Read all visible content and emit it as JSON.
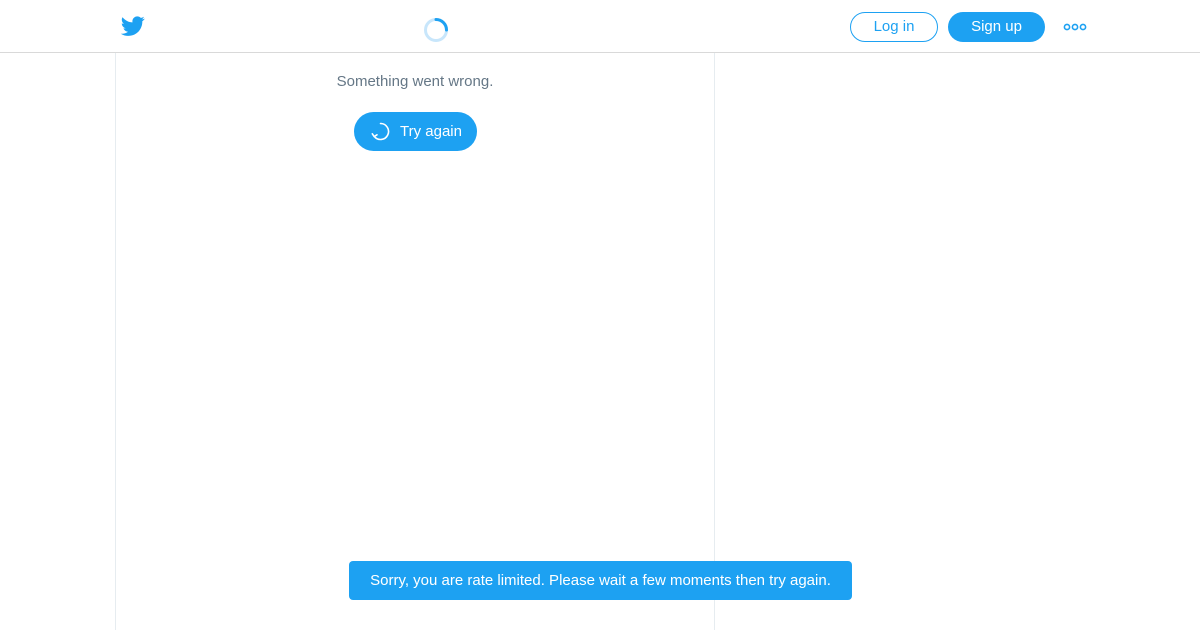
{
  "header": {
    "logo_icon": "twitter-bird-icon",
    "loading_icon": "spinner-icon",
    "login_label": "Log in",
    "signup_label": "Sign up",
    "more_icon": "more-options-icon"
  },
  "main": {
    "error_message": "Something went wrong.",
    "retry_icon": "refresh-icon",
    "retry_label": "Try again"
  },
  "toast": {
    "message": "Sorry, you are rate limited. Please wait a few moments then try again."
  },
  "colors": {
    "accent": "#1da1f2",
    "muted_text": "#657786",
    "border": "#e6ecf0"
  }
}
